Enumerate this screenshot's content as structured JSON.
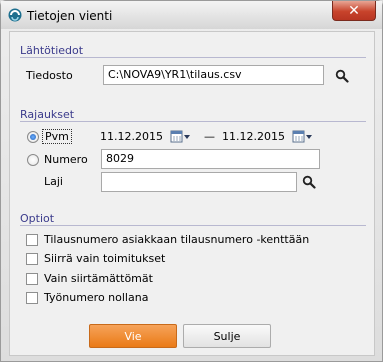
{
  "window": {
    "title": "Tietojen vienti",
    "close_glyph": "✕"
  },
  "source_group": {
    "title": "Lähtötiedot",
    "file_label": "Tiedosto",
    "file_value": "C:\\NOVA9\\YR1\\tilaus.csv"
  },
  "limits_group": {
    "title": "Rajaukset",
    "pvm_label": "Pvm",
    "pvm_selected": true,
    "date_from": "11.12.2015",
    "date_separator": "—",
    "date_to": "11.12.2015",
    "numero_label": "Numero",
    "numero_selected": false,
    "numero_value": "8029",
    "laji_label": "Laji",
    "laji_value": ""
  },
  "options_group": {
    "title": "Optiot",
    "options": [
      {
        "label": "Tilausnumero asiakkaan tilausnumero -kenttään",
        "checked": false
      },
      {
        "label": "Siirrä vain toimitukset",
        "checked": false
      },
      {
        "label": "Vain siirtämättömät",
        "checked": false
      },
      {
        "label": "Työnumero nollana",
        "checked": false
      }
    ]
  },
  "buttons": {
    "export_label": "Vie",
    "close_label": "Sulje"
  },
  "colors": {
    "accent": "#ea7a16",
    "group_title": "#3b3b8c",
    "close_button": "#c8432b"
  }
}
